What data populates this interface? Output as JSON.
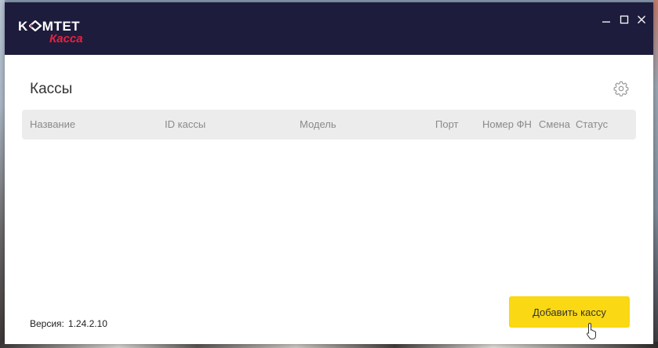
{
  "brand": {
    "name_prefix": "K",
    "name_suffix": "MTET",
    "subtitle": "Касса",
    "accent_color": "#e4233c",
    "titlebar_color": "#1e1c3d"
  },
  "window_controls": {
    "minimize_icon": "minimize-icon",
    "maximize_icon": "maximize-icon",
    "close_icon": "close-icon"
  },
  "page": {
    "title": "Кассы",
    "settings_icon": "gear-icon"
  },
  "table": {
    "columns": [
      "Название",
      "ID кассы",
      "Модель",
      "Порт",
      "Номер ФН",
      "Смена",
      "Статус"
    ],
    "rows": []
  },
  "footer": {
    "version_label": "Версия:",
    "version_value": "1.24.2.10",
    "add_button_label": "Добавить кассу",
    "add_button_color": "#fad813"
  }
}
